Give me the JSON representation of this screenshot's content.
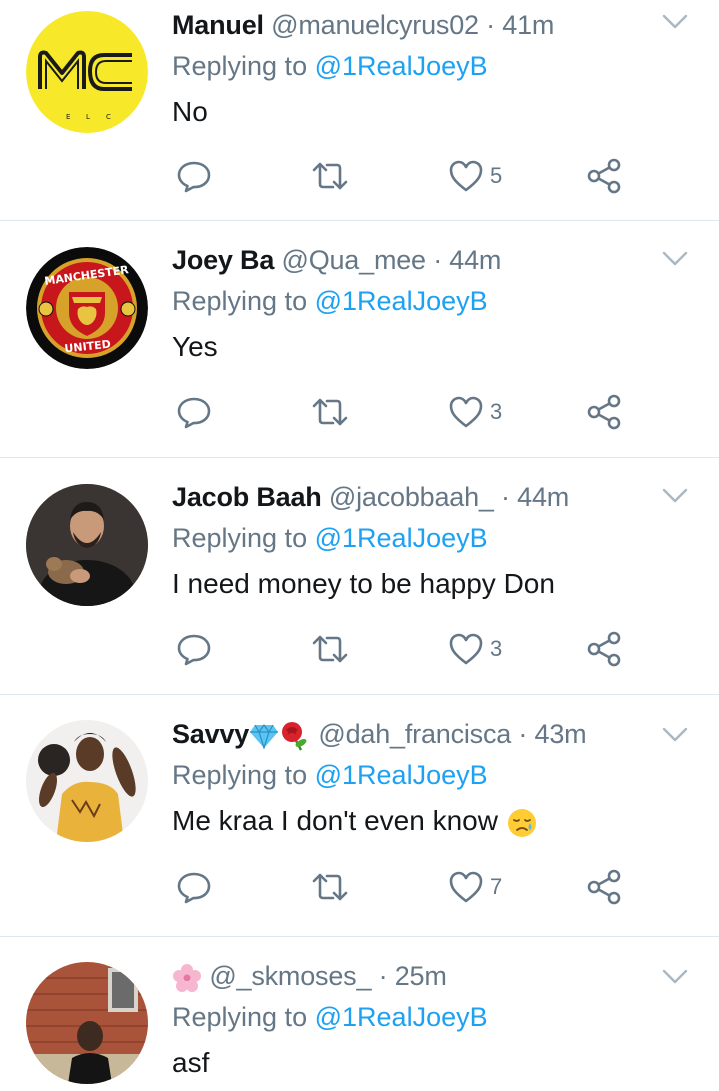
{
  "tweets": [
    {
      "display_name": "Manuel",
      "handle": "@manuelcyrus02",
      "separator": "·",
      "time": "41m",
      "reply_prefix": "Replying to",
      "reply_to": "@1RealJoeyB",
      "text": "No",
      "likes": "5",
      "avatar": "mc-logo-avatar"
    },
    {
      "display_name": "Joey Ba",
      "handle": "@Qua_mee",
      "separator": "·",
      "time": "44m",
      "reply_prefix": "Replying to",
      "reply_to": "@1RealJoeyB",
      "text": "Yes",
      "likes": "3",
      "avatar": "manchester-united-crest-avatar",
      "avatar_text_top": "MANCHESTER",
      "avatar_text_bottom": "UNITED"
    },
    {
      "display_name": "Jacob Baah",
      "handle": "@jacobbaah_",
      "separator": "·",
      "time": "44m",
      "reply_prefix": "Replying to",
      "reply_to": "@1RealJoeyB",
      "text": "I need money to be happy Don",
      "likes": "3",
      "avatar": "person-with-dog-photo-avatar"
    },
    {
      "display_name": "Savvy",
      "name_emojis": [
        "gem-emoji",
        "rose-emoji"
      ],
      "handle": "@dah_francisca",
      "separator": "·",
      "time": "43m",
      "reply_prefix": "Replying to",
      "reply_to": "@1RealJoeyB",
      "text": "Me kraa I don't even know",
      "text_emoji": "sad-relieved-face-emoji",
      "likes": "7",
      "avatar": "woman-photo-avatar"
    },
    {
      "display_name": "",
      "name_emojis": [
        "cherry-blossom-emoji"
      ],
      "handle": "@_skmoses_",
      "separator": "·",
      "time": "25m",
      "reply_prefix": "Replying to",
      "reply_to": "@1RealJoeyB",
      "text": "asf",
      "avatar": "person-brick-wall-photo-avatar"
    }
  ],
  "colors": {
    "text": "#14171a",
    "secondary": "#657786",
    "link": "#1da1f2",
    "divider": "#e1e8ed"
  },
  "icons": {
    "reply": "reply-icon",
    "retweet": "retweet-icon",
    "like": "heart-icon",
    "share": "share-icon",
    "menu": "chevron-down-icon"
  }
}
